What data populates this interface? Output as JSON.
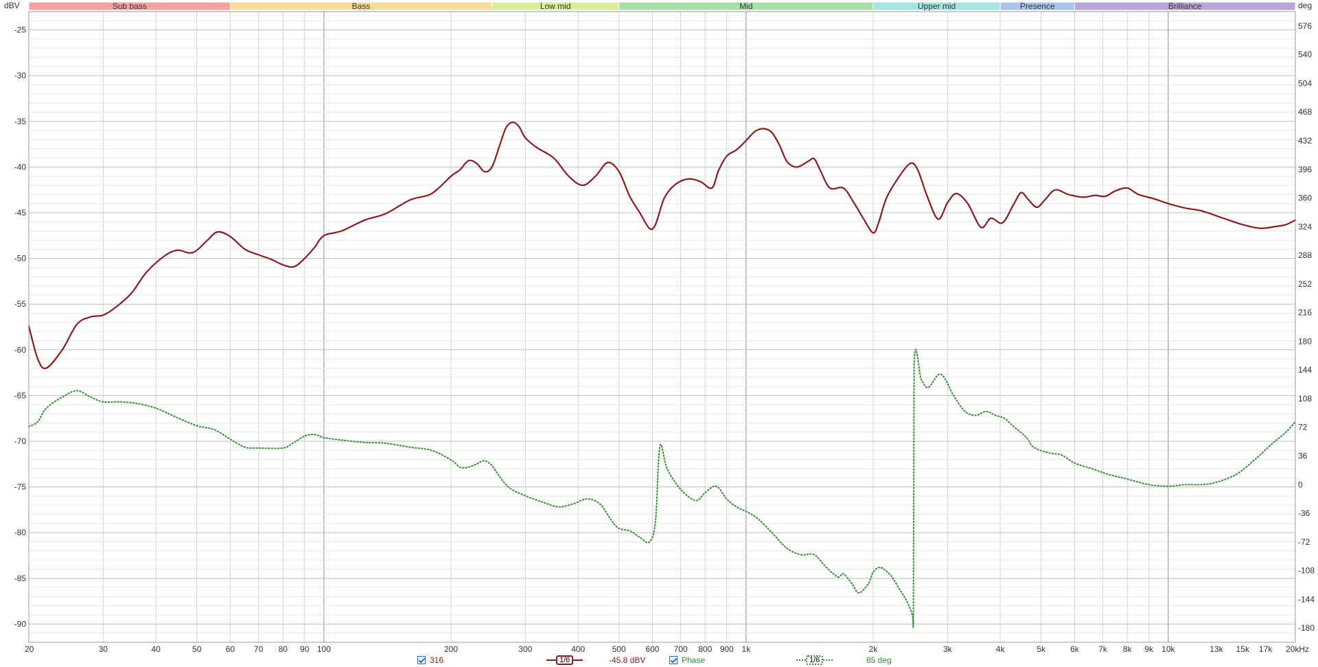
{
  "chart_data": {
    "type": "line",
    "x_scale": "log",
    "xlim": [
      20,
      20000
    ],
    "ylim": [
      -92,
      -23
    ],
    "y2lim": [
      -198,
      594
    ],
    "left_unit": "dBV",
    "right_unit": "deg",
    "grid": "on",
    "x_ticks": [
      {
        "v": 20,
        "label": "20"
      },
      {
        "v": 30,
        "label": "30"
      },
      {
        "v": 40,
        "label": "40"
      },
      {
        "v": 50,
        "label": "50"
      },
      {
        "v": 60,
        "label": "60"
      },
      {
        "v": 70,
        "label": "70"
      },
      {
        "v": 80,
        "label": "80"
      },
      {
        "v": 90,
        "label": "90"
      },
      {
        "v": 100,
        "label": "100"
      },
      {
        "v": 200,
        "label": "200"
      },
      {
        "v": 300,
        "label": "300"
      },
      {
        "v": 400,
        "label": "400"
      },
      {
        "v": 500,
        "label": "500"
      },
      {
        "v": 600,
        "label": "600"
      },
      {
        "v": 700,
        "label": "700"
      },
      {
        "v": 800,
        "label": "800"
      },
      {
        "v": 900,
        "label": "900"
      },
      {
        "v": 1000,
        "label": "1k"
      },
      {
        "v": 2000,
        "label": "2k"
      },
      {
        "v": 3000,
        "label": "3k"
      },
      {
        "v": 4000,
        "label": "4k"
      },
      {
        "v": 5000,
        "label": "5k"
      },
      {
        "v": 6000,
        "label": "6k"
      },
      {
        "v": 7000,
        "label": "7k"
      },
      {
        "v": 8000,
        "label": "8k"
      },
      {
        "v": 9000,
        "label": "9k"
      },
      {
        "v": 10000,
        "label": "10k"
      },
      {
        "v": 13000,
        "label": "13k"
      },
      {
        "v": 15000,
        "label": "15k"
      },
      {
        "v": 17000,
        "label": "17k"
      },
      {
        "v": 20000,
        "label": "20kHz"
      }
    ],
    "y_ticks": [
      -25,
      -30,
      -35,
      -40,
      -45,
      -50,
      -55,
      -60,
      -65,
      -70,
      -75,
      -80,
      -85,
      -90
    ],
    "y2_ticks": [
      576,
      540,
      504,
      468,
      432,
      396,
      360,
      324,
      288,
      252,
      216,
      180,
      144,
      108,
      72,
      36,
      0,
      -36,
      -72,
      -108,
      -144,
      -180
    ],
    "bands": [
      {
        "name": "Sub bass",
        "from": 20,
        "to": 60,
        "color": "#f4a3a3"
      },
      {
        "name": "Bass",
        "from": 60,
        "to": 250,
        "color": "#f6dc9a"
      },
      {
        "name": "Low mid",
        "from": 250,
        "to": 500,
        "color": "#d9ec9e"
      },
      {
        "name": "Mid",
        "from": 500,
        "to": 2000,
        "color": "#a6e0a6"
      },
      {
        "name": "Upper mid",
        "from": 2000,
        "to": 4000,
        "color": "#a6e4e0"
      },
      {
        "name": "Presence",
        "from": 4000,
        "to": 6000,
        "color": "#a9c4ea"
      },
      {
        "name": "Brilliance",
        "from": 6000,
        "to": 20000,
        "color": "#b9a6d9"
      }
    ],
    "series": [
      {
        "name": "316",
        "axis": "left",
        "color": "#8b1a1a",
        "style": "solid",
        "points": [
          [
            20,
            -57.4
          ],
          [
            21,
            -61.0
          ],
          [
            22,
            -62.0
          ],
          [
            24,
            -60.0
          ],
          [
            26,
            -57.2
          ],
          [
            28,
            -56.4
          ],
          [
            30,
            -56.2
          ],
          [
            32,
            -55.4
          ],
          [
            35,
            -53.8
          ],
          [
            38,
            -51.5
          ],
          [
            42,
            -49.7
          ],
          [
            45,
            -49.1
          ],
          [
            48,
            -49.4
          ],
          [
            50,
            -49.1
          ],
          [
            53,
            -48.0
          ],
          [
            56,
            -47.1
          ],
          [
            60,
            -47.6
          ],
          [
            65,
            -49.0
          ],
          [
            70,
            -49.6
          ],
          [
            75,
            -50.1
          ],
          [
            80,
            -50.7
          ],
          [
            85,
            -50.9
          ],
          [
            90,
            -50.0
          ],
          [
            95,
            -48.8
          ],
          [
            100,
            -47.5
          ],
          [
            110,
            -47.0
          ],
          [
            125,
            -45.8
          ],
          [
            140,
            -45.1
          ],
          [
            160,
            -43.6
          ],
          [
            180,
            -42.9
          ],
          [
            200,
            -41.0
          ],
          [
            210,
            -40.3
          ],
          [
            220,
            -39.3
          ],
          [
            230,
            -39.6
          ],
          [
            240,
            -40.5
          ],
          [
            250,
            -40.0
          ],
          [
            260,
            -37.8
          ],
          [
            270,
            -35.7
          ],
          [
            280,
            -35.1
          ],
          [
            290,
            -35.6
          ],
          [
            300,
            -36.8
          ],
          [
            320,
            -37.9
          ],
          [
            350,
            -39.0
          ],
          [
            380,
            -41.0
          ],
          [
            410,
            -42.0
          ],
          [
            440,
            -41.0
          ],
          [
            470,
            -39.5
          ],
          [
            500,
            -40.5
          ],
          [
            530,
            -43.2
          ],
          [
            560,
            -45.0
          ],
          [
            590,
            -46.7
          ],
          [
            610,
            -46.3
          ],
          [
            640,
            -43.4
          ],
          [
            680,
            -41.9
          ],
          [
            730,
            -41.3
          ],
          [
            780,
            -41.6
          ],
          [
            830,
            -42.3
          ],
          [
            860,
            -40.4
          ],
          [
            900,
            -38.8
          ],
          [
            950,
            -38.1
          ],
          [
            1000,
            -37.1
          ],
          [
            1050,
            -36.1
          ],
          [
            1100,
            -35.8
          ],
          [
            1150,
            -36.2
          ],
          [
            1200,
            -37.6
          ],
          [
            1250,
            -39.4
          ],
          [
            1320,
            -40.0
          ],
          [
            1400,
            -39.4
          ],
          [
            1450,
            -39.1
          ],
          [
            1500,
            -40.4
          ],
          [
            1580,
            -42.3
          ],
          [
            1700,
            -42.3
          ],
          [
            1800,
            -43.9
          ],
          [
            1900,
            -45.7
          ],
          [
            2000,
            -47.2
          ],
          [
            2060,
            -46.1
          ],
          [
            2150,
            -43.4
          ],
          [
            2300,
            -41.1
          ],
          [
            2450,
            -39.6
          ],
          [
            2550,
            -40.3
          ],
          [
            2680,
            -43.1
          ],
          [
            2850,
            -45.7
          ],
          [
            3000,
            -43.9
          ],
          [
            3150,
            -42.9
          ],
          [
            3350,
            -44.0
          ],
          [
            3600,
            -46.6
          ],
          [
            3800,
            -45.6
          ],
          [
            4050,
            -46.1
          ],
          [
            4300,
            -44.1
          ],
          [
            4480,
            -42.8
          ],
          [
            4650,
            -43.5
          ],
          [
            4880,
            -44.4
          ],
          [
            5100,
            -43.6
          ],
          [
            5400,
            -42.5
          ],
          [
            5800,
            -43.0
          ],
          [
            6300,
            -43.3
          ],
          [
            6700,
            -43.1
          ],
          [
            7100,
            -43.2
          ],
          [
            7500,
            -42.6
          ],
          [
            8000,
            -42.3
          ],
          [
            8500,
            -43.0
          ],
          [
            9300,
            -43.5
          ],
          [
            10000,
            -44.0
          ],
          [
            11000,
            -44.5
          ],
          [
            12000,
            -44.8
          ],
          [
            13500,
            -45.6
          ],
          [
            15000,
            -46.3
          ],
          [
            16500,
            -46.7
          ],
          [
            18000,
            -46.5
          ],
          [
            19000,
            -46.3
          ],
          [
            20000,
            -45.8
          ]
        ]
      },
      {
        "name": "Phase",
        "axis": "right",
        "color": "#2f8f2f",
        "style": "dotted",
        "points": [
          [
            20,
            73
          ],
          [
            21,
            79
          ],
          [
            22,
            96
          ],
          [
            24,
            110
          ],
          [
            26,
            118
          ],
          [
            28,
            110
          ],
          [
            30,
            104
          ],
          [
            33,
            104
          ],
          [
            36,
            102
          ],
          [
            40,
            96
          ],
          [
            45,
            84
          ],
          [
            50,
            74
          ],
          [
            55,
            69
          ],
          [
            60,
            57
          ],
          [
            65,
            47
          ],
          [
            70,
            46
          ],
          [
            80,
            46
          ],
          [
            85,
            53
          ],
          [
            90,
            61
          ],
          [
            95,
            63
          ],
          [
            100,
            59
          ],
          [
            110,
            56
          ],
          [
            125,
            53
          ],
          [
            140,
            52
          ],
          [
            160,
            47
          ],
          [
            180,
            43
          ],
          [
            200,
            31
          ],
          [
            210,
            22
          ],
          [
            220,
            22
          ],
          [
            230,
            26
          ],
          [
            240,
            30
          ],
          [
            250,
            24
          ],
          [
            260,
            11
          ],
          [
            275,
            -4
          ],
          [
            300,
            -14
          ],
          [
            330,
            -22
          ],
          [
            360,
            -28
          ],
          [
            390,
            -24
          ],
          [
            420,
            -18
          ],
          [
            450,
            -24
          ],
          [
            480,
            -45
          ],
          [
            500,
            -55
          ],
          [
            530,
            -58
          ],
          [
            560,
            -66
          ],
          [
            590,
            -72
          ],
          [
            610,
            -46
          ],
          [
            625,
            48
          ],
          [
            650,
            20
          ],
          [
            700,
            -6
          ],
          [
            760,
            -20
          ],
          [
            800,
            -10
          ],
          [
            850,
            -2
          ],
          [
            900,
            -18
          ],
          [
            950,
            -28
          ],
          [
            1050,
            -40
          ],
          [
            1150,
            -60
          ],
          [
            1250,
            -80
          ],
          [
            1350,
            -88
          ],
          [
            1450,
            -88
          ],
          [
            1550,
            -104
          ],
          [
            1650,
            -116
          ],
          [
            1700,
            -112
          ],
          [
            1780,
            -124
          ],
          [
            1850,
            -136
          ],
          [
            1950,
            -124
          ],
          [
            2000,
            -110
          ],
          [
            2080,
            -104
          ],
          [
            2200,
            -114
          ],
          [
            2300,
            -130
          ],
          [
            2400,
            -146
          ],
          [
            2480,
            -165
          ],
          [
            2490,
            -180
          ],
          [
            2500,
            150
          ],
          [
            2600,
            132
          ],
          [
            2700,
            122
          ],
          [
            2850,
            138
          ],
          [
            2950,
            134
          ],
          [
            3100,
            112
          ],
          [
            3300,
            92
          ],
          [
            3500,
            87
          ],
          [
            3700,
            92
          ],
          [
            3900,
            87
          ],
          [
            4100,
            83
          ],
          [
            4300,
            73
          ],
          [
            4600,
            60
          ],
          [
            4800,
            47
          ],
          [
            5200,
            40
          ],
          [
            5600,
            37
          ],
          [
            6000,
            27
          ],
          [
            6600,
            20
          ],
          [
            7200,
            13
          ],
          [
            8000,
            7
          ],
          [
            9000,
            0
          ],
          [
            10000,
            -2
          ],
          [
            11000,
            0
          ],
          [
            12000,
            0
          ],
          [
            13000,
            3
          ],
          [
            14500,
            13
          ],
          [
            16000,
            31
          ],
          [
            17500,
            50
          ],
          [
            19000,
            66
          ],
          [
            20000,
            79
          ]
        ]
      }
    ]
  },
  "legend": {
    "series1_label": "316",
    "smoothing1_label": "1/6",
    "series1_readout": "-45.8 dBV",
    "series2_label": "Phase",
    "smoothing2_label": "1/6",
    "series2_readout": "85 deg"
  }
}
